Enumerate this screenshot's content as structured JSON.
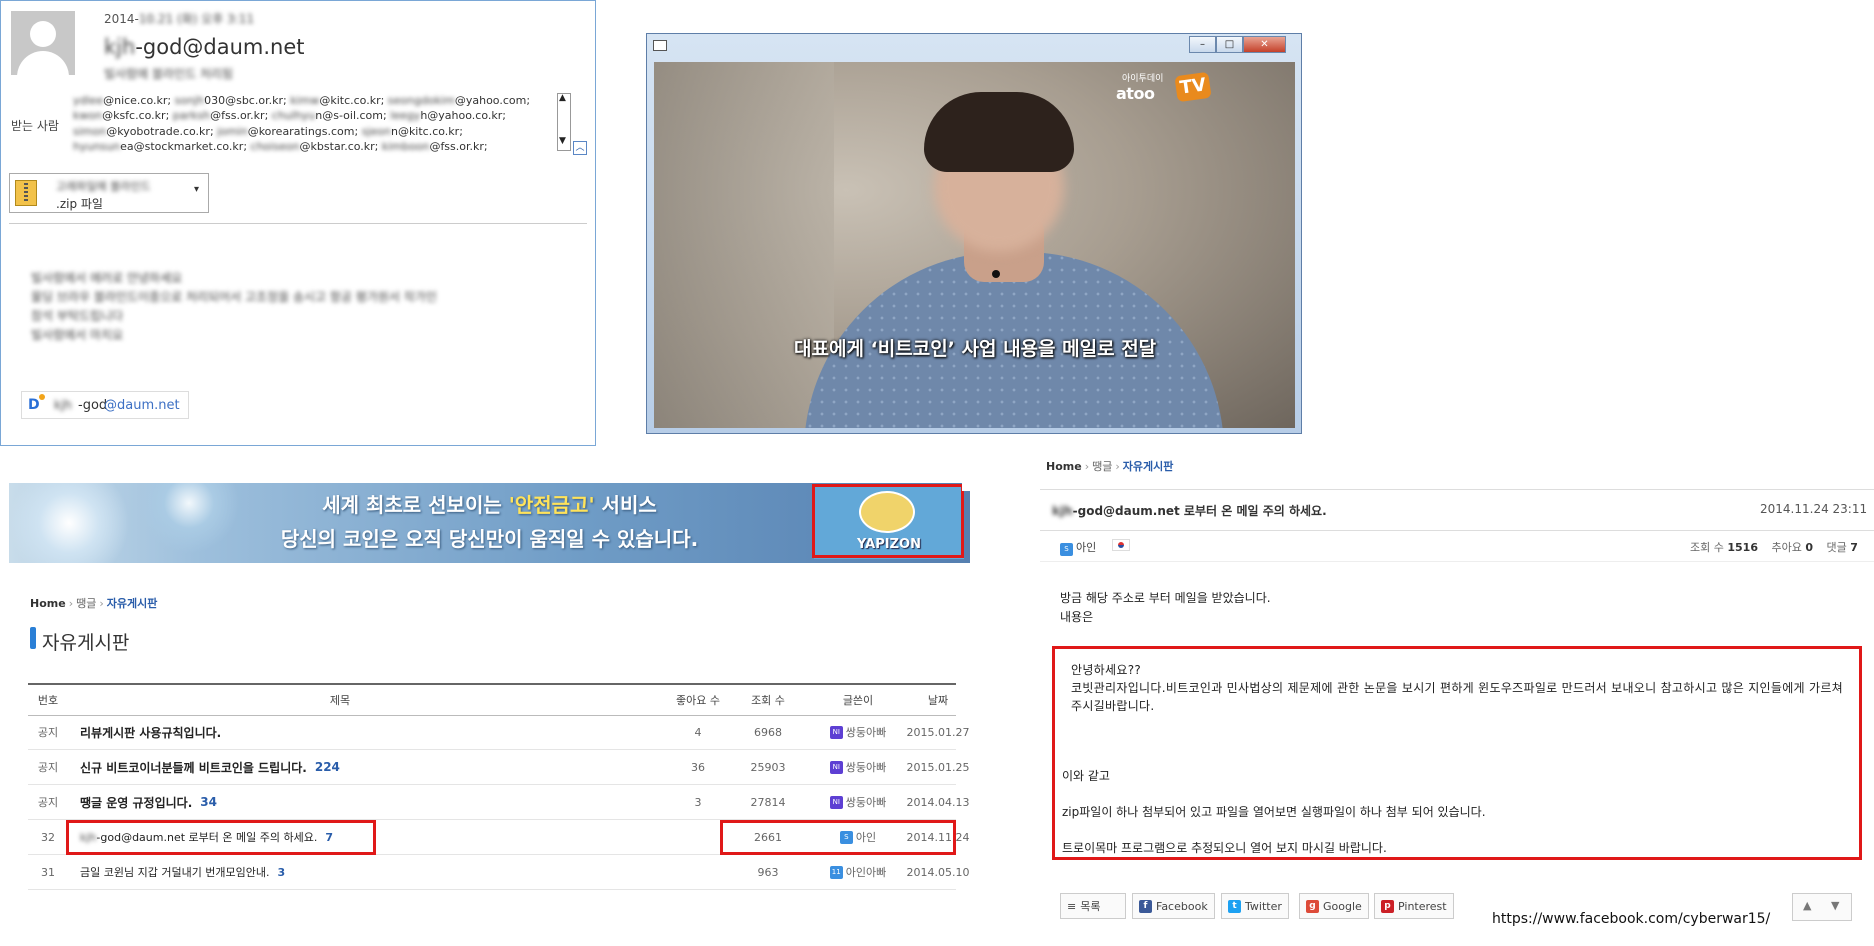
{
  "email": {
    "date": "2014-",
    "date_blurred": "10.21 (화) 오후 3:11",
    "sender_blurred": "kjh",
    "sender_rest": "-god@daum.net",
    "sender_name_blurred": "빌사람에 블라인드 처리됨",
    "to_label": "받는 사람",
    "recipients": [
      [
        {
          "b": "ydlee"
        },
        {
          "t": "@nice.co.kr; "
        },
        {
          "b": "sonjh"
        },
        {
          "t": "030@sbc.or.kr; "
        },
        {
          "b": "kimw"
        },
        {
          "t": "@kitc.co.kr; "
        },
        {
          "b": "seongdokim"
        },
        {
          "t": "@yahoo.com;"
        }
      ],
      [
        {
          "b": "kwon"
        },
        {
          "t": "@ksfc.co.kr; "
        },
        {
          "b": "parksh"
        },
        {
          "t": "@fss.or.kr; "
        },
        {
          "b": "chulhyu"
        },
        {
          "t": "n@s-oil.com; "
        },
        {
          "b": "leegy"
        },
        {
          "t": "h@yahoo.co.kr;"
        }
      ],
      [
        {
          "b": "simon"
        },
        {
          "t": "@kyobotrade.co.kr; "
        },
        {
          "b": "jomin"
        },
        {
          "t": "@korearatings.com; "
        },
        {
          "b": "sjeon"
        },
        {
          "t": "n@kitc.co.kr;"
        }
      ],
      [
        {
          "b": "hyunsun"
        },
        {
          "t": "ea@stockmarket.co.kr; "
        },
        {
          "b": "choiseon"
        },
        {
          "t": "@kbstar.co.kr; "
        },
        {
          "b": "kimboon"
        },
        {
          "t": "@fss.or.kr;"
        }
      ]
    ],
    "attachment_name_blurred": "고래파일에 블라인드",
    "attachment_type": ".zip 파일",
    "body_blurred": [
      "빌사람에서 에러로 안녕하세요",
      "물딩 브라우 블라인드이중으로 처리되어서 고조정을 송시고 항공 평가원서 작가인",
      "참석 부탁드립니다",
      "빌사람에서 마치요"
    ],
    "signature_blurred": "kjh",
    "signature_god": "-god",
    "signature_domain": "@daum.net"
  },
  "video": {
    "logo_small": "아이투데이",
    "logo": "atoo",
    "logo_tv": "TV",
    "caption": "대표에게 ‘비트코인’ 사업 내용을 메일로 전달"
  },
  "banner": {
    "line1_pre": "세계 최초로 선보이는 ",
    "line1_hl": "'안전금고'",
    "line1_post": " 서비스",
    "line2": "당신의 코인은 오직 당신만이 움직일 수 있습니다.",
    "brand": "YAPIZON"
  },
  "breadcrumb_left": {
    "home": "Home",
    "mid": "땡글",
    "current": "자유게시판"
  },
  "board_title": "자유게시판",
  "list": {
    "headers": {
      "no": "번호",
      "title": "제목",
      "likes": "좋아요 수",
      "views": "조회 수",
      "author": "글쓴이",
      "date": "날짜"
    },
    "rows": [
      {
        "no": "공지",
        "title": "리뷰게시판 사용규칙입니다.",
        "comments": "",
        "likes": "4",
        "views": "6968",
        "author": "쌍둥아빠",
        "date": "2015.01.27"
      },
      {
        "no": "공지",
        "title": "신규 비트코이너분들께 비트코인을 드립니다.",
        "comments": "224",
        "likes": "36",
        "views": "25903",
        "author": "쌍둥아빠",
        "date": "2015.01.25"
      },
      {
        "no": "공지",
        "title": "땡글 운영 규정입니다.",
        "comments": "34",
        "likes": "3",
        "views": "27814",
        "author": "쌍둥아빠",
        "date": "2014.04.13"
      },
      {
        "no": "32",
        "title_blurred": "kjh",
        "title": "-god@daum.net 로부터 온 메일 주의 하세요.",
        "comments": "7",
        "likes": "",
        "views": "2661",
        "author": "아인",
        "date": "2014.11.24"
      },
      {
        "no": "31",
        "title": "금일 코윈님 지갑 거덜내기 번개모임안내.",
        "comments": "3",
        "likes": "",
        "views": "963",
        "author": "아인아빠",
        "date": "2014.05.10"
      }
    ]
  },
  "breadcrumb_right": {
    "home": "Home",
    "mid": "땡글",
    "current": "자유게시판"
  },
  "post": {
    "title_blurred": "kjh",
    "title": "-god@daum.net 로부터 온 메일 주의 하세요.",
    "date": "2014.11.24 23:11",
    "author": "아인",
    "views_label": "조회 수",
    "views": "1516",
    "likes_label": "추아요",
    "likes": "0",
    "comments_label": "댓글",
    "comments": "7",
    "intro": [
      "방금 해당 주소로 부터 메일을 받았습니다.",
      "내용은"
    ],
    "quote_lines": [
      "안녕하세요??",
      "코빗관리자입니다.비트코인과 민사법상의 제문제에 관한 논문을 보시기 편하게 윈도우즈파일로 만드러서 보내오니 참고하시고 많은 지인들에게 가르쳐주시길바랍니다."
    ],
    "quote_2": "이와 같고",
    "quote_3": "zip파일이 하나 첨부되어 있고 파일을 열어보면 실행파일이 하나 첨부 되어 있습니다.",
    "quote_4": "트로이목마 프로그램으로 추정되오니 열어 보지 마시길 바랍니다.",
    "share": {
      "list": "목록",
      "facebook": "Facebook",
      "twitter": "Twitter",
      "google": "Google",
      "pinterest": "Pinterest"
    }
  },
  "footer_link": "https://www.facebook.com/cyberwar15/",
  "colors": {
    "highlight_box": "#e01818",
    "link_blue": "#2a5daa",
    "email_border": "#7aa7d6"
  }
}
